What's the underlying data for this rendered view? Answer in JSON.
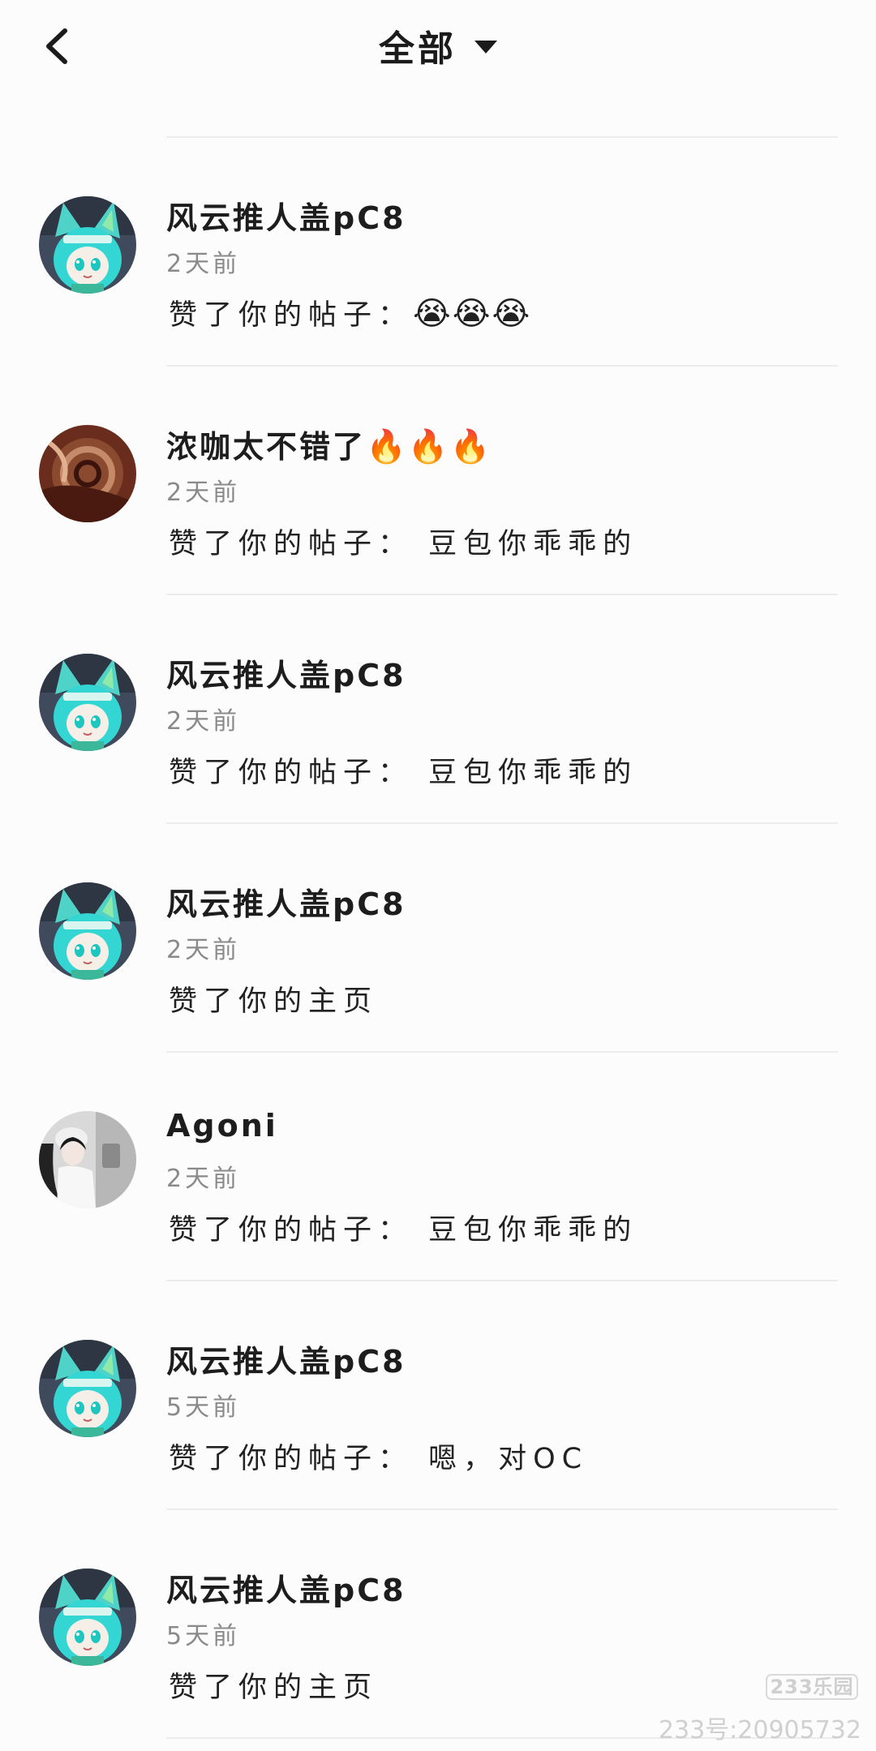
{
  "header": {
    "title": "全部"
  },
  "notifications": [
    {
      "avatar": "cyan-catgirl",
      "user": "风云推人盖pC8",
      "time": "2天前",
      "message": "赞了你的帖子：",
      "emoji": "😭😭😭"
    },
    {
      "avatar": "chocolate-swirl",
      "user": "浓咖太不错了",
      "user_emoji": "🔥🔥🔥",
      "time": "2天前",
      "message": "赞了你的帖子： 豆包你乖乖的",
      "emoji": ""
    },
    {
      "avatar": "cyan-catgirl",
      "user": "风云推人盖pC8",
      "time": "2天前",
      "message": "赞了你的帖子： 豆包你乖乖的",
      "emoji": ""
    },
    {
      "avatar": "cyan-catgirl",
      "user": "风云推人盖pC8",
      "time": "2天前",
      "message": "赞了你的主页",
      "emoji": ""
    },
    {
      "avatar": "girl-photo",
      "user": "Agoni",
      "time": "2天前",
      "message": "赞了你的帖子： 豆包你乖乖的",
      "emoji": ""
    },
    {
      "avatar": "cyan-catgirl",
      "user": "风云推人盖pC8",
      "time": "5天前",
      "message": "赞了你的帖子： 嗯，对OC",
      "emoji": ""
    },
    {
      "avatar": "cyan-catgirl",
      "user": "风云推人盖pC8",
      "time": "5天前",
      "message": "赞了你的主页",
      "emoji": ""
    }
  ],
  "watermark": {
    "logo": "233乐园",
    "id": "233号:20905732"
  }
}
